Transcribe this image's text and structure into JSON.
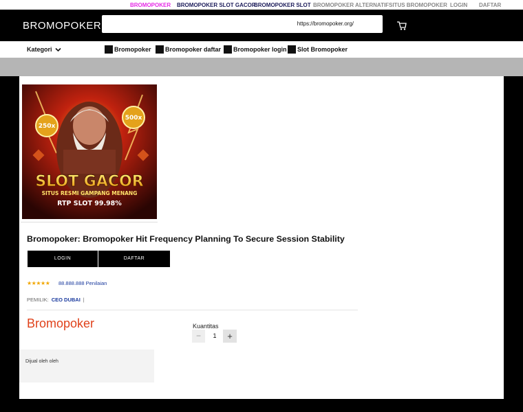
{
  "topnav": {
    "items": [
      {
        "label": "BROMOPOKER",
        "color": "#e62ae6"
      },
      {
        "label": "BROMOPOKER SLOT GACOR",
        "color": "#1c1c5a"
      },
      {
        "label": "BROMOPOKER SLOT",
        "color": "#1c1c5a"
      },
      {
        "label": "BROMOPOKER ALTERNATIF",
        "color": "#888888"
      },
      {
        "label": "SITUS BROMOPOKER",
        "color": "#888888"
      },
      {
        "label": "LOGIN",
        "color": "#888888"
      },
      {
        "label": "DAFTAR",
        "color": "#888888"
      }
    ]
  },
  "header": {
    "logo": "BROMOPOKER",
    "search_value": "https://bromopoker.org/",
    "cart_icon": "cart-icon"
  },
  "catbar": {
    "kategori": "Kategori",
    "links": [
      "Bromopoker",
      "Bromopoker daftar",
      "Bromopoker login",
      "Slot Bromopoker"
    ]
  },
  "product": {
    "image": {
      "badge_left": "250x",
      "badge_right": "500x",
      "headline": "SLOT GACOR",
      "subline": "SITUS RESMI GAMPANG MENANG",
      "rtp": "RTP SLOT 99.98%"
    },
    "title": "Bromopoker: Bromopoker Hit Frequency Planning To Secure Session Stability",
    "buttons": {
      "login": "LOGIN",
      "daftar": "DAFTAR"
    },
    "stars": "★★★★★",
    "rating_text": "88.888.888 Penilaian",
    "owner_label": "PEMILIK:",
    "owner_name": "CEO DUBAI",
    "owner_sep": "|",
    "brand": "Bromopoker",
    "quantity_label": "Kuantitas",
    "quantity_value": "1",
    "seller_text": "Dijual oleh oleh"
  },
  "colors": {
    "accent": "#e0421b",
    "link": "#1a3a9e",
    "star": "#f1a600"
  }
}
